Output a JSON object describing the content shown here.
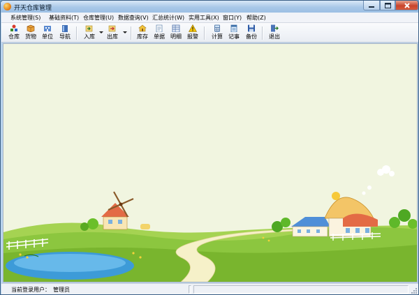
{
  "window": {
    "title": "开天仓库管理"
  },
  "menu": [
    "系统管理(S)",
    "基础资料(T)",
    "仓库管理(U)",
    "数据查询(V)",
    "汇总统计(W)",
    "实用工具(X)",
    "窗口(Y)",
    "帮助(Z)"
  ],
  "toolbar": {
    "warehouse": "仓库",
    "goods": "货物",
    "unit": "单位",
    "nav": "导航",
    "stock_in": "入库",
    "stock_out": "出库",
    "inventory": "库存",
    "documents": "单据",
    "details": "明细",
    "alarm": "报警",
    "calculator": "计算",
    "notes": "记事",
    "backup": "备份",
    "exit": "退出"
  },
  "status": {
    "label": "当前登录用户：",
    "user": "管理员"
  },
  "colors": {
    "sky": "#f1f5e0",
    "grass": "#8cc63f",
    "water": "#3d9bd8",
    "roof": "#e36b45"
  }
}
